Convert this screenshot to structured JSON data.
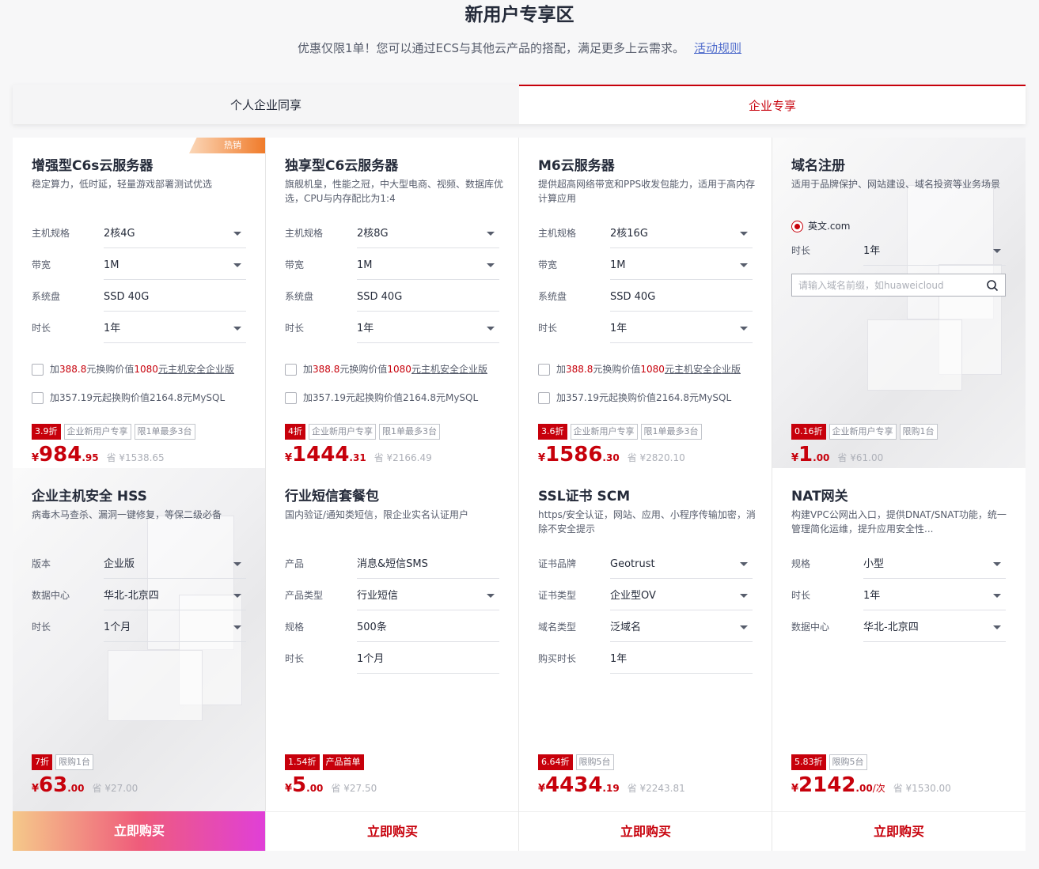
{
  "header": {
    "title": "新用户专享区",
    "subtitle": "优惠仅限1单！您可以通过ECS与其他云产品的搭配，满足更多上云需求。",
    "rules_link": "活动规则"
  },
  "tabs": [
    {
      "label": "个人企业同享",
      "active": false
    },
    {
      "label": "企业专享",
      "active": true
    }
  ],
  "row1": [
    {
      "badge": "热销",
      "title": "增强型C6s云服务器",
      "desc": "稳定算力，低时延，轻量游戏部署测试优选",
      "fields": [
        {
          "label": "主机规格",
          "value": "2核4G",
          "dropdown": true
        },
        {
          "label": "带宽",
          "value": "1M",
          "dropdown": true
        },
        {
          "label": "系统盘",
          "value": "SSD 40G",
          "dropdown": false
        },
        {
          "label": "时长",
          "value": "1年",
          "dropdown": true
        }
      ],
      "addon1": {
        "pre": "加",
        "price": "388.8",
        "mid": "元换购价值",
        "value": "1080",
        "post": "元主机安全企业版"
      },
      "addon2": "加357.19元起换购价值2164.8元MySQL",
      "discount": "3.9折",
      "tags": [
        "企业新用户专享",
        "限1单最多3台"
      ],
      "price_int": "984",
      "price_dec": ".95",
      "unit": "",
      "save": "省 ¥1538.65",
      "buy": "立即购买"
    },
    {
      "title": "独享型C6云服务器",
      "desc": "旗舰机皇，性能之冠，中大型电商、视频、数据库优选，CPU与内存配比为1:4",
      "fields": [
        {
          "label": "主机规格",
          "value": "2核8G",
          "dropdown": true
        },
        {
          "label": "带宽",
          "value": "1M",
          "dropdown": true
        },
        {
          "label": "系统盘",
          "value": "SSD 40G",
          "dropdown": false
        },
        {
          "label": "时长",
          "value": "1年",
          "dropdown": true
        }
      ],
      "addon1": {
        "pre": "加",
        "price": "388.8",
        "mid": "元换购价值",
        "value": "1080",
        "post": "元主机安全企业版"
      },
      "addon2": "加357.19元起换购价值2164.8元MySQL",
      "discount": "4折",
      "tags": [
        "企业新用户专享",
        "限1单最多3台"
      ],
      "price_int": "1444",
      "price_dec": ".31",
      "unit": "",
      "save": "省 ¥2166.49",
      "buy": "立即购买"
    },
    {
      "title": "M6云服务器",
      "desc": "提供超高网络带宽和PPS收发包能力，适用于高内存计算应用",
      "fields": [
        {
          "label": "主机规格",
          "value": "2核16G",
          "dropdown": true
        },
        {
          "label": "带宽",
          "value": "1M",
          "dropdown": true
        },
        {
          "label": "系统盘",
          "value": "SSD 40G",
          "dropdown": false
        },
        {
          "label": "时长",
          "value": "1年",
          "dropdown": true
        }
      ],
      "addon1": {
        "pre": "加",
        "price": "388.8",
        "mid": "元换购价值",
        "value": "1080",
        "post": "元主机安全企业版"
      },
      "addon2": "加357.19元起换购价值2164.8元MySQL",
      "discount": "3.6折",
      "tags": [
        "企业新用户专享",
        "限1单最多3台"
      ],
      "price_int": "1586",
      "price_dec": ".30",
      "unit": "",
      "save": "省 ¥2820.10",
      "buy": "立即购买"
    },
    {
      "title": "域名注册",
      "desc": "适用于品牌保护、网站建设、域名投资等业务场景",
      "radio_label": "英文.com",
      "fields": [
        {
          "label": "时长",
          "value": "1年",
          "dropdown": true
        }
      ],
      "search_placeholder": "请输入域名前缀，如huaweicloud",
      "discount": "0.16折",
      "tags": [
        "企业新用户专享",
        "限购1台"
      ],
      "price_int": "1",
      "price_dec": ".00",
      "unit": "",
      "save": "省 ¥61.00",
      "buy": "立即购买"
    }
  ],
  "row2": [
    {
      "title": "企业主机安全 HSS",
      "desc": "病毒木马查杀、漏洞一键修复，等保二级必备",
      "fields": [
        {
          "label": "版本",
          "value": "企业版",
          "dropdown": true
        },
        {
          "label": "数据中心",
          "value": "华北-北京四",
          "dropdown": true
        },
        {
          "label": "时长",
          "value": "1个月",
          "dropdown": true
        }
      ],
      "discount": "7折",
      "tags": [
        "限购1台"
      ],
      "price_int": "63",
      "price_dec": ".00",
      "unit": "",
      "save": "省 ¥27.00",
      "buy": "立即购买"
    },
    {
      "title": "行业短信套餐包",
      "desc": "国内验证/通知类短信，限企业实名认证用户",
      "fields": [
        {
          "label": "产品",
          "value": "消息&短信SMS",
          "dropdown": false
        },
        {
          "label": "产品类型",
          "value": "行业短信",
          "dropdown": true
        },
        {
          "label": "规格",
          "value": "500条",
          "dropdown": false
        },
        {
          "label": "时长",
          "value": "1个月",
          "dropdown": false
        }
      ],
      "discount": "1.54折",
      "tags_red": [
        "产品首单"
      ],
      "tags": [],
      "price_int": "5",
      "price_dec": ".00",
      "unit": "",
      "save": "省 ¥27.50",
      "buy": "立即购买"
    },
    {
      "title": "SSL证书 SCM",
      "desc": "https/安全认证，网站、应用、小程序传输加密，消除不安全提示",
      "fields": [
        {
          "label": "证书品牌",
          "value": "Geotrust",
          "dropdown": true
        },
        {
          "label": "证书类型",
          "value": "企业型OV",
          "dropdown": true
        },
        {
          "label": "域名类型",
          "value": "泛域名",
          "dropdown": true
        },
        {
          "label": "购买时长",
          "value": "1年",
          "dropdown": false
        }
      ],
      "discount": "6.64折",
      "tags": [
        "限购5台"
      ],
      "price_int": "4434",
      "price_dec": ".19",
      "unit": "",
      "save": "省 ¥2243.81",
      "buy": "立即购买"
    },
    {
      "title": "NAT网关",
      "desc": "构建VPC公网出入口，提供DNAT/SNAT功能，统一管理简化运维，提升应用安全性...",
      "fields": [
        {
          "label": "规格",
          "value": "小型",
          "dropdown": true
        },
        {
          "label": "时长",
          "value": "1年",
          "dropdown": true
        },
        {
          "label": "数据中心",
          "value": "华北-北京四",
          "dropdown": true
        }
      ],
      "discount": "5.83折",
      "tags": [
        "限购5台"
      ],
      "price_int": "2142",
      "price_dec": ".00",
      "unit": "/次",
      "save": "省 ¥1530.00",
      "buy": "立即购买"
    }
  ],
  "colors": {
    "accent": "#c7000b",
    "link": "#526ecc"
  }
}
